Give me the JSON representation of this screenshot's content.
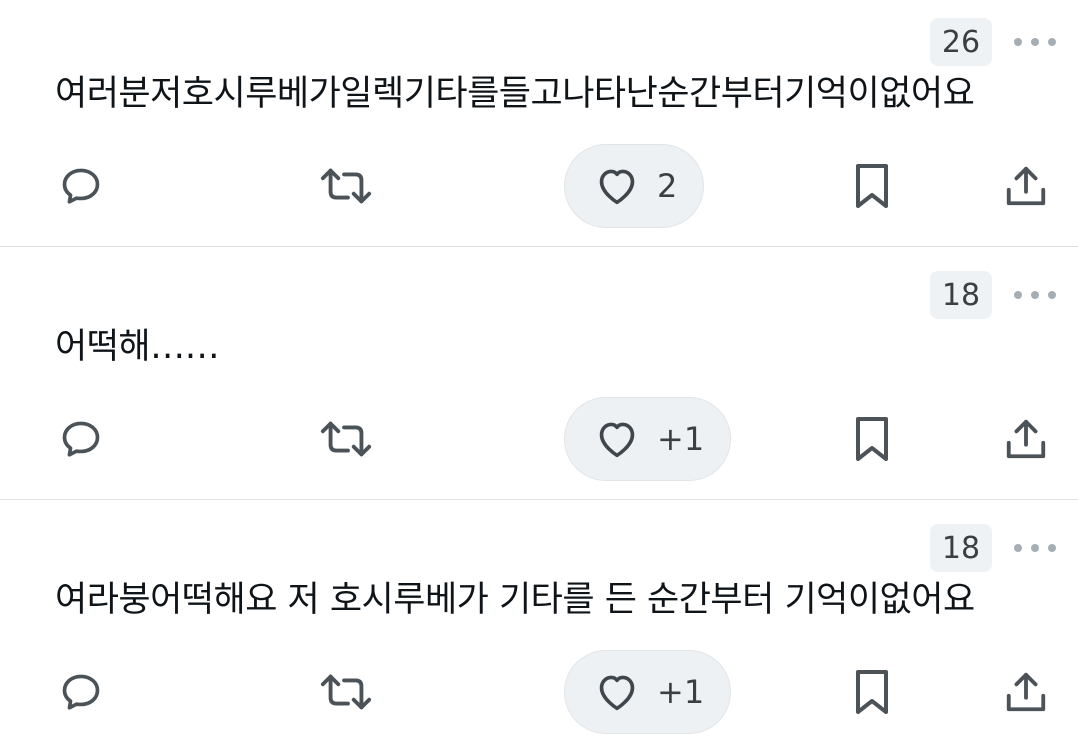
{
  "posts": [
    {
      "view_count": "26",
      "text": "여러분저호시루베가일렉기타를들고나타난순간부터기억이없어요",
      "like_count": "2"
    },
    {
      "view_count": "18",
      "text": "어떡해……",
      "like_count": "+1"
    },
    {
      "view_count": "18",
      "text": "여라붕어떡해요 저 호시루베가 기타를 든 순간부터 기억이없어요",
      "like_count": "+1"
    }
  ],
  "icons": {
    "reply": "reply-icon",
    "retweet": "retweet-icon",
    "like": "heart-icon",
    "bookmark": "bookmark-icon",
    "share": "share-icon",
    "more": "more-icon"
  },
  "colors": {
    "icon": "#4b5258",
    "text": "#0f1419",
    "chip_bg": "#eef2f4",
    "divider": "#dfe3e6"
  }
}
